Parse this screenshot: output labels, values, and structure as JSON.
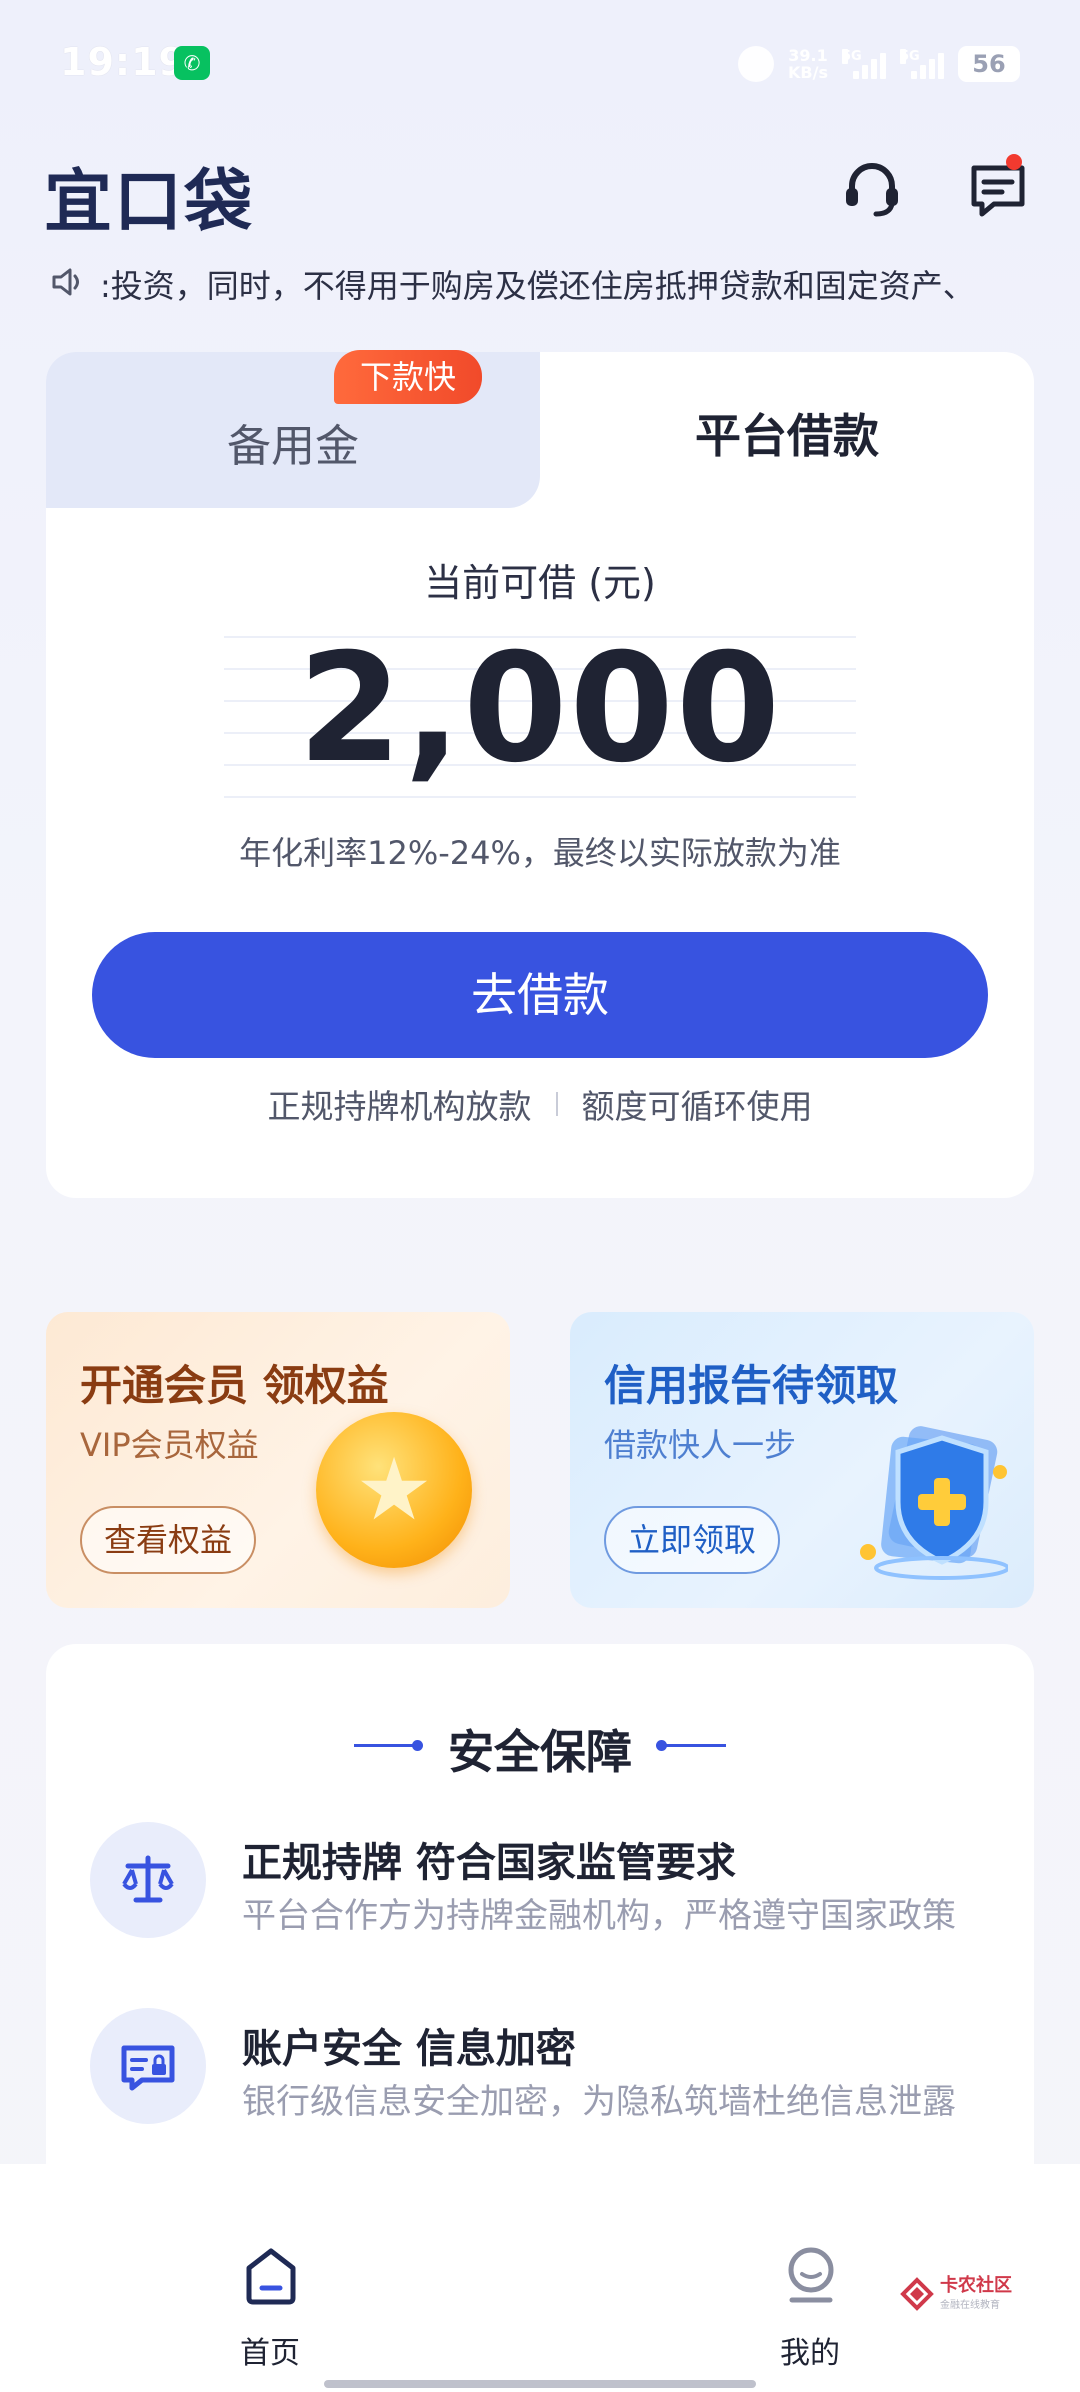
{
  "status_bar": {
    "time": "19:19",
    "net_speed_value": "39.1",
    "net_speed_unit": "KB/s",
    "signal1": "5G",
    "signal2": "5G",
    "battery": "56"
  },
  "header": {
    "logo": "宜口袋",
    "support_icon": "headset-icon",
    "message_icon": "message-icon"
  },
  "notice": {
    "icon": "speaker-icon",
    "text": ":投资，同时，不得用于购房及偿还住房抵押贷款和固定资产、"
  },
  "loan_card": {
    "tabs": [
      {
        "label": "备用金",
        "badge": "下款快",
        "active": false
      },
      {
        "label": "平台借款",
        "active": true
      }
    ],
    "amount_label": "当前可借 (元)",
    "amount": "2,000",
    "rate_text": "年化利率12%-24%，最终以实际放款为准",
    "borrow_button": "去借款",
    "features": [
      "正规持牌机构放款",
      "额度可循环使用"
    ]
  },
  "promos": [
    {
      "title": "开通会员 领权益",
      "subtitle": "VIP会员权益",
      "button": "查看权益"
    },
    {
      "title": "信用报告待领取",
      "subtitle": "借款快人一步",
      "button": "立即领取"
    }
  ],
  "security": {
    "title": "安全保障",
    "items": [
      {
        "icon": "scale-icon",
        "title": "正规持牌 符合国家监管要求",
        "desc": "平台合作方为持牌金融机构，严格遵守国家政策"
      },
      {
        "icon": "id-card-lock-icon",
        "title": "账户安全 信息加密",
        "desc": "银行级信息安全加密，为隐私筑墙杜绝信息泄露"
      }
    ]
  },
  "bottom_nav": {
    "items": [
      {
        "label": "首页",
        "icon": "home-icon",
        "active": true
      },
      {
        "label": "我的",
        "icon": "profile-icon",
        "active": false
      }
    ]
  },
  "watermark": {
    "title": "卡农社区",
    "subtitle": "金融在线教育"
  },
  "colors": {
    "primary": "#3853e0",
    "badge": "#f14a2a",
    "text": "#1f2333",
    "muted": "#9a9db0"
  }
}
